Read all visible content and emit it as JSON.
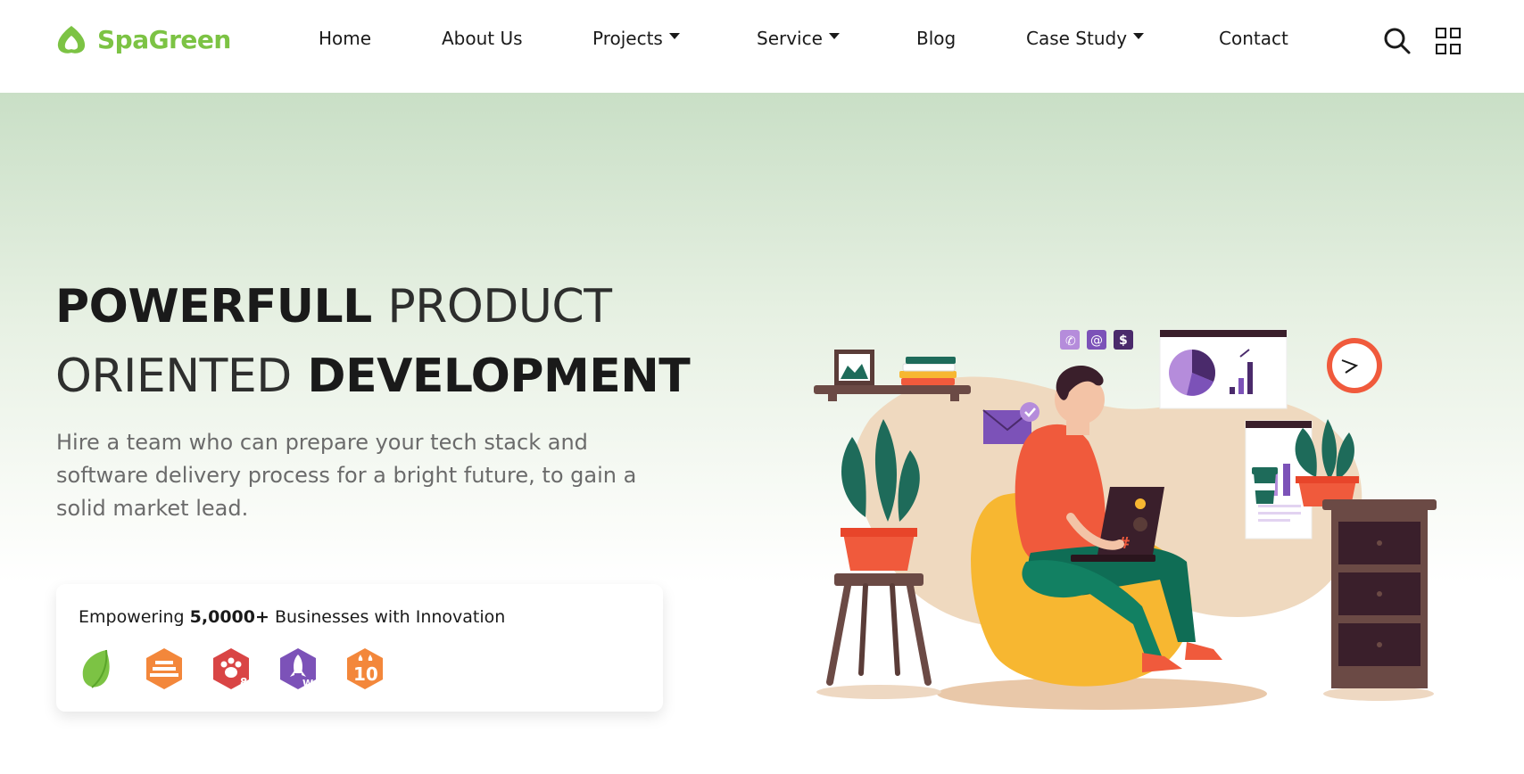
{
  "header": {
    "logo_text": "SpaGreen",
    "nav": [
      {
        "label": "Home",
        "dropdown": false
      },
      {
        "label": "About Us",
        "dropdown": false
      },
      {
        "label": "Projects",
        "dropdown": true
      },
      {
        "label": "Service",
        "dropdown": true
      },
      {
        "label": "Blog",
        "dropdown": false
      },
      {
        "label": "Case Study",
        "dropdown": true
      },
      {
        "label": "Contact",
        "dropdown": false
      }
    ],
    "icons": {
      "search": "search-icon",
      "menu": "grid-menu-icon"
    }
  },
  "hero": {
    "headline": {
      "line1_bold": "POWERFULL",
      "line1_thin": "PRODUCT",
      "line2_thin": "ORIENTED",
      "line2_bold": "DEVELOPMENT"
    },
    "subtitle": "Hire a team who can prepare your tech stack and software delivery process for a bright future, to gain a solid market lead."
  },
  "card": {
    "text_prefix": "Empowering",
    "text_bold": "5,0000+",
    "text_suffix": "Businesses with Innovation",
    "brand_icons": [
      "leaf-brand-icon",
      "stack-brand-icon",
      "paw-brand-icon",
      "rocket-brand-icon",
      "ten-brand-icon"
    ],
    "brand_badges": [
      "",
      "",
      "8",
      "W",
      "10"
    ]
  },
  "colors": {
    "brand_green": "#7cc344",
    "hero_top": "#c9dfc6",
    "text_dark": "#1a1a1a",
    "text_muted": "#6b6b6b",
    "hoodie": "#f05a3c",
    "beanbag": "#f7b731",
    "purple": "#6b3fa0"
  }
}
